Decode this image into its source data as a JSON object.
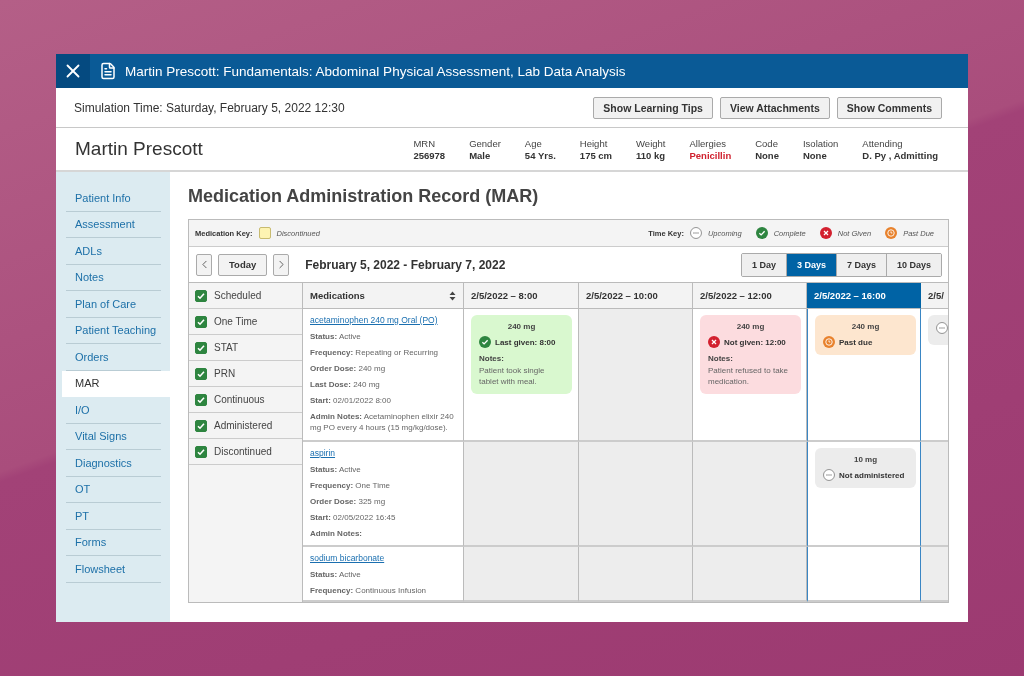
{
  "window": {
    "title": "Martin Prescott: Fundamentals: Abdominal Physical Assessment, Lab Data Analysis"
  },
  "simulation_time": "Simulation Time: Saturday, February 5, 2022 12:30",
  "header_buttons": [
    "Show Learning Tips",
    "View Attachments",
    "Show Comments"
  ],
  "patient": {
    "name": "Martin Prescott",
    "fields": [
      {
        "label": "MRN",
        "value": "256978",
        "alert": false
      },
      {
        "label": "Gender",
        "value": "Male",
        "alert": false
      },
      {
        "label": "Age",
        "value": "54 Yrs.",
        "alert": false
      },
      {
        "label": "Height",
        "value": "175 cm",
        "alert": false
      },
      {
        "label": "Weight",
        "value": "110 kg",
        "alert": false
      },
      {
        "label": "Allergies",
        "value": "Penicillin",
        "alert": true
      },
      {
        "label": "Code",
        "value": "None",
        "alert": false
      },
      {
        "label": "Isolation",
        "value": "None",
        "alert": false
      },
      {
        "label": "Attending",
        "value": "D. Py , Admitting",
        "alert": false
      }
    ]
  },
  "sidebar": {
    "items": [
      {
        "label": "Patient Info",
        "selected": false
      },
      {
        "label": "Assessment",
        "selected": false
      },
      {
        "label": "ADLs",
        "selected": false
      },
      {
        "label": "Notes",
        "selected": false
      },
      {
        "label": "Plan of Care",
        "selected": false
      },
      {
        "label": "Patient Teaching",
        "selected": false
      },
      {
        "label": "Orders",
        "selected": false
      },
      {
        "label": "MAR",
        "selected": true
      },
      {
        "label": "I/O",
        "selected": false
      },
      {
        "label": "Vital Signs",
        "selected": false
      },
      {
        "label": "Diagnostics",
        "selected": false
      },
      {
        "label": "OT",
        "selected": false
      },
      {
        "label": "PT",
        "selected": false
      },
      {
        "label": "Forms",
        "selected": false
      },
      {
        "label": "Flowsheet",
        "selected": false
      }
    ]
  },
  "page_title": "Medication Administration Record (MAR)",
  "medication_key": {
    "label": "Medication Key:",
    "items": [
      {
        "kind": "discontinued",
        "label": "Discontinued"
      }
    ]
  },
  "time_key": {
    "label": "Time Key:",
    "items": [
      {
        "kind": "upcoming",
        "label": "Upcoming"
      },
      {
        "kind": "complete",
        "label": "Complete"
      },
      {
        "kind": "not_given",
        "label": "Not Given"
      },
      {
        "kind": "past_due",
        "label": "Past Due"
      }
    ]
  },
  "date_nav": {
    "today": "Today",
    "range": "February 5, 2022 - February 7, 2022",
    "views": [
      {
        "label": "1 Day",
        "selected": false
      },
      {
        "label": "3 Days",
        "selected": true
      },
      {
        "label": "7 Days",
        "selected": false
      },
      {
        "label": "10 Days",
        "selected": false
      }
    ]
  },
  "filters": [
    {
      "label": "Scheduled",
      "checked": true
    },
    {
      "label": "One Time",
      "checked": true
    },
    {
      "label": "STAT",
      "checked": true
    },
    {
      "label": "PRN",
      "checked": true
    },
    {
      "label": "Continuous",
      "checked": true
    },
    {
      "label": "Administered",
      "checked": true
    },
    {
      "label": "Discontinued",
      "checked": true
    }
  ],
  "table": {
    "medications_header": "Medications",
    "columns": [
      {
        "label": "2/5/2022 – 8:00",
        "selected": false
      },
      {
        "label": "2/5/2022 – 10:00",
        "selected": false
      },
      {
        "label": "2/5/2022 – 12:00",
        "selected": false
      },
      {
        "label": "2/5/2022 – 16:00",
        "selected": true
      },
      {
        "label": "2/5/",
        "selected": false
      }
    ],
    "rows": [
      {
        "name": "acetaminophen 240 mg Oral (PO)",
        "details": [
          {
            "label": "Status:",
            "value": "Active"
          },
          {
            "label": "Frequency:",
            "value": "Repeating or Recurring"
          },
          {
            "label": "Order Dose:",
            "value": "240 mg"
          },
          {
            "label": "Last Dose:",
            "value": "240 mg"
          },
          {
            "label": "Start:",
            "value": "02/01/2022 8:00"
          },
          {
            "label": "Admin Notes:",
            "value": "Acetaminophen elixir 240 mg PO every 4 hours (15 mg/kg/dose)."
          }
        ],
        "doses": [
          {
            "kind": "complete",
            "dose": "240 mg",
            "label": "Last given: 8:00",
            "notes_label": "Notes:",
            "notes": "Patient took single tablet with meal."
          },
          {
            "kind": "empty"
          },
          {
            "kind": "not_given",
            "dose": "240 mg",
            "label": "Not given: 12:00",
            "notes_label": "Notes:",
            "notes": "Patient refused to take medication."
          },
          {
            "kind": "past_due",
            "dose": "240 mg",
            "label": "Past due"
          },
          {
            "kind": "upcoming"
          }
        ]
      },
      {
        "name": "aspirin",
        "details": [
          {
            "label": "Status:",
            "value": "Active"
          },
          {
            "label": "Frequency:",
            "value": "One Time"
          },
          {
            "label": "Order Dose:",
            "value": "325 mg"
          },
          {
            "label": "Start:",
            "value": "02/05/2022 16:45"
          },
          {
            "label": "Admin Notes:"
          }
        ],
        "doses": [
          {
            "kind": "empty"
          },
          {
            "kind": "empty"
          },
          {
            "kind": "empty"
          },
          {
            "kind": "upcoming",
            "dose": "10 mg",
            "label": "Not administered"
          },
          {
            "kind": "empty"
          }
        ]
      },
      {
        "name": "sodium bicarbonate",
        "details": [
          {
            "label": "Status:",
            "value": "Active"
          },
          {
            "label": "Frequency:",
            "value": "Continuous Infusion"
          }
        ],
        "doses": [
          {
            "kind": "empty"
          },
          {
            "kind": "empty"
          },
          {
            "kind": "empty"
          },
          {
            "kind": "empty"
          },
          {
            "kind": "empty"
          }
        ]
      }
    ]
  }
}
